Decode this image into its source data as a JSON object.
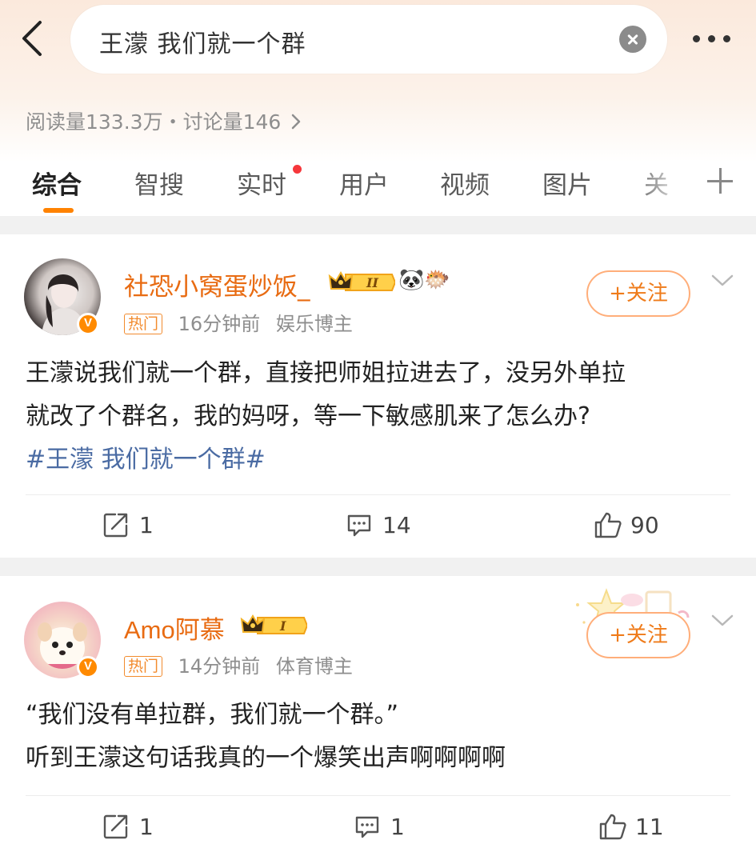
{
  "header": {
    "search_query": "王濛 我们就一个群",
    "stats": "阅读量133.3万・讨论量146"
  },
  "tabs": [
    {
      "label": "综合"
    },
    {
      "label": "智搜"
    },
    {
      "label": "实时"
    },
    {
      "label": "用户"
    },
    {
      "label": "视频"
    },
    {
      "label": "图片"
    },
    {
      "label": "关"
    }
  ],
  "colors": {
    "accent": "#ff8200",
    "username": "#e86b12",
    "hashtag": "#4a6ba3"
  },
  "posts": [
    {
      "username": "社恐小窝蛋炒饭_",
      "level": "II",
      "emojis": "🐼🐡",
      "hot_label": "热门",
      "time": "16分钟前",
      "role": "娱乐博主",
      "follow_label": "+关注",
      "text_line1": "王濛说我们就一个群，直接把师姐拉进去了，没另外单拉",
      "text_line2": "就改了个群名，我的妈呀，等一下敏感肌来了怎么办?",
      "hashtag": "#王濛 我们就一个群#",
      "reposts": "1",
      "comments": "14",
      "likes": "90"
    },
    {
      "username": "Amo阿慕",
      "level": "I",
      "hot_label": "热门",
      "time": "14分钟前",
      "role": "体育博主",
      "follow_label": "+关注",
      "text_line1": "“我们没有单拉群，我们就一个群。”",
      "text_line2": "听到王濛这句话我真的一个爆笑出声啊啊啊啊",
      "reposts": "1",
      "comments": "1",
      "likes": "11"
    }
  ]
}
